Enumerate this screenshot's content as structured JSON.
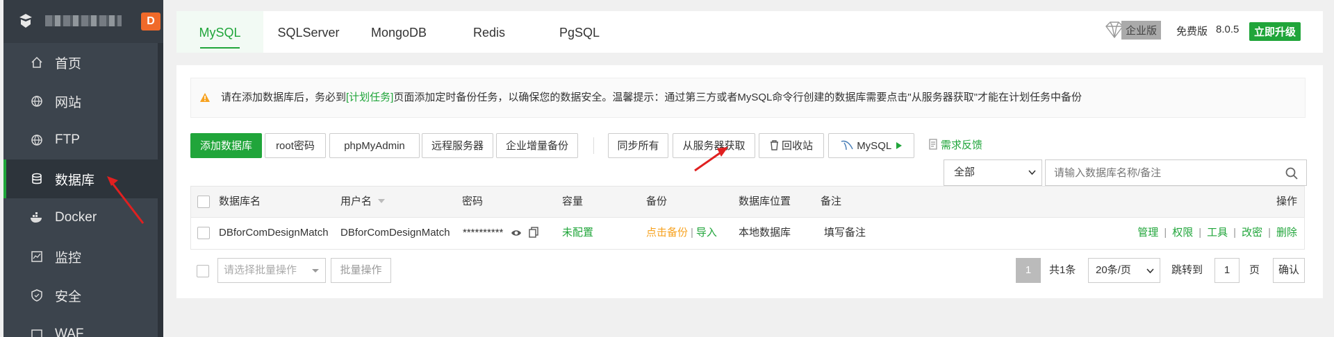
{
  "sidebar": {
    "logo_badge": "D",
    "items": [
      {
        "label": "首页",
        "icon": "home-icon"
      },
      {
        "label": "网站",
        "icon": "globe-icon"
      },
      {
        "label": "FTP",
        "icon": "globe-icon"
      },
      {
        "label": "数据库",
        "icon": "database-icon",
        "active": true
      },
      {
        "label": "Docker",
        "icon": "docker-icon"
      },
      {
        "label": "监控",
        "icon": "monitor-icon"
      },
      {
        "label": "安全",
        "icon": "shield-icon"
      },
      {
        "label": "WAF",
        "icon": "waf-icon"
      }
    ]
  },
  "tabs": [
    "MySQL",
    "SQLServer",
    "MongoDB",
    "Redis",
    "PgSQL"
  ],
  "version": {
    "enterprise": "企业版",
    "free": "免费版",
    "number": "8.0.5",
    "upgrade": "立即升级"
  },
  "notice": {
    "before": "请在添加数据库后，务必到",
    "link": "[计划任务]",
    "after": "页面添加定时备份任务，以确保您的数据安全。温馨提示：通过第三方或者MySQL命令行创建的数据库需要点击\"从服务器获取\"才能在计划任务中备份"
  },
  "toolbar": {
    "add_db": "添加数据库",
    "root_pw": "root密码",
    "phpmyadmin": "phpMyAdmin",
    "remote": "远程服务器",
    "backup": "企业增量备份",
    "sync_all": "同步所有",
    "fetch": "从服务器获取",
    "recycle": "回收站",
    "mysql": "MySQL",
    "feedback": "需求反馈"
  },
  "filter": {
    "scope": "全部",
    "search_placeholder": "请输入数据库名称/备注"
  },
  "table": {
    "headers": {
      "name": "数据库名",
      "user": "用户名",
      "password": "密码",
      "capacity": "容量",
      "backup": "备份",
      "location": "数据库位置",
      "remark": "备注",
      "ops": "操作"
    },
    "rows": [
      {
        "name": "DBforComDesignMatch",
        "user": "DBforComDesignMatch",
        "password": "**********",
        "capacity": "未配置",
        "backup_click": "点击备份",
        "import": "导入",
        "location": "本地数据库",
        "remark": "填写备注",
        "ops": [
          "管理",
          "权限",
          "工具",
          "改密",
          "删除"
        ]
      }
    ]
  },
  "footer": {
    "batch_placeholder": "请选择批量操作",
    "batch_button": "批量操作",
    "page": "1",
    "total": "共1条",
    "per_page": "20条/页",
    "jump_to": "跳转到",
    "jump_value": "1",
    "page_unit": "页",
    "confirm": "确认"
  },
  "colors": {
    "accent": "#20a53a",
    "sidebar_bg": "#3c444d",
    "warning": "#f7a21f",
    "annotation_arrow": "#e02020"
  }
}
